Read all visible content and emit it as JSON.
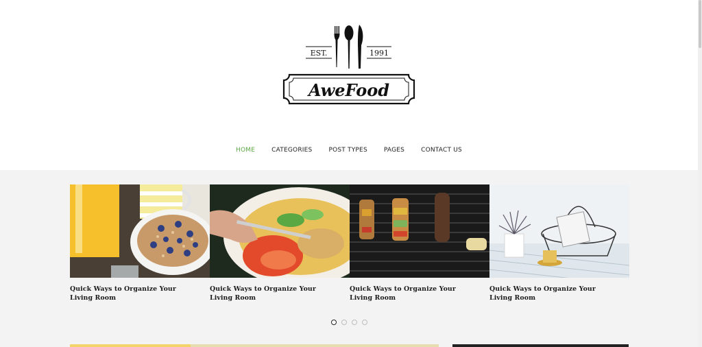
{
  "logo": {
    "est_label": "EST.",
    "year_label": "1991",
    "brand_name": "AweFood"
  },
  "nav": {
    "items": [
      {
        "label": "HOME",
        "active": true
      },
      {
        "label": "CATEGORIES"
      },
      {
        "label": "POST TYPES"
      },
      {
        "label": "PAGES"
      },
      {
        "label": "CONTACT US"
      }
    ]
  },
  "slider": {
    "slides": [
      {
        "title": "Quick Ways to Organize Your Living Room",
        "image": "breakfast-cereal-juice"
      },
      {
        "title": "Quick Ways to Organize Your Living Room",
        "image": "salad-plate-fork"
      },
      {
        "title": "Quick Ways to Organize Your Living Room",
        "image": "grilled-kebabs"
      },
      {
        "title": "Quick Ways to Organize Your Living Room",
        "image": "wire-basket-plant-coffee"
      }
    ],
    "dots": 4,
    "active_dot": 1
  },
  "colors": {
    "accent": "#5aa844",
    "text": "#222222",
    "page_bg": "#f3f3f3",
    "header_bg": "#ffffff"
  }
}
